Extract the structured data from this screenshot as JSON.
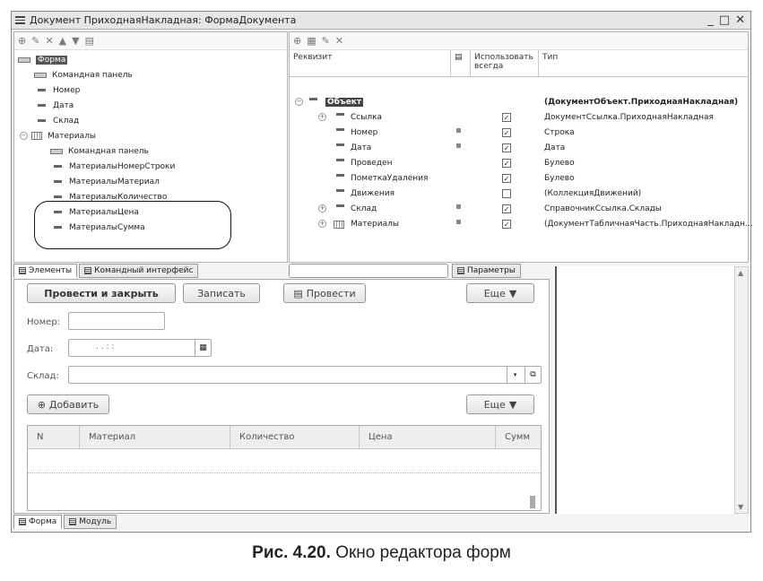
{
  "window": {
    "title": "Документ ПриходнаяНакладная: ФормаДокумента",
    "controls": [
      "_",
      "□",
      "✕"
    ]
  },
  "tree": {
    "items": [
      {
        "label": "Форма",
        "level": 0,
        "icon": "form-icon",
        "selected": true
      },
      {
        "label": "Командная панель",
        "level": 1,
        "icon": "command-panel-icon"
      },
      {
        "label": "Номер",
        "level": 1,
        "icon": "field-icon"
      },
      {
        "label": "Дата",
        "level": 1,
        "icon": "field-icon"
      },
      {
        "label": "Склад",
        "level": 1,
        "icon": "field-icon"
      },
      {
        "label": "Материалы",
        "level": 1,
        "icon": "table-icon",
        "expandable": true
      },
      {
        "label": "Командная панель",
        "level": 2,
        "icon": "command-panel-icon"
      },
      {
        "label": "МатериалыНомерСтроки",
        "level": 2,
        "icon": "field-icon"
      },
      {
        "label": "МатериалыМатериал",
        "level": 2,
        "icon": "field-icon"
      },
      {
        "label": "МатериалыКоличество",
        "level": 2,
        "icon": "field-icon"
      },
      {
        "label": "МатериалыЦена",
        "level": 2,
        "icon": "field-icon"
      },
      {
        "label": "МатериалыСумма",
        "level": 2,
        "icon": "field-icon"
      }
    ]
  },
  "left_tabs": {
    "elements": "Элементы",
    "command_interface": "Командный интерфейс"
  },
  "props": {
    "headers": {
      "name": "Реквизит",
      "use_always": "Использовать всегда",
      "type": "Тип"
    },
    "rows": [
      {
        "name": "Объект",
        "type": "(ДокументОбъект.ПриходнаяНакладная)",
        "root": true,
        "checked": null,
        "sq": false
      },
      {
        "name": "Ссылка",
        "type": "ДокументСсылка.ПриходнаяНакладная",
        "expandable": true,
        "checked": true,
        "sq": false
      },
      {
        "name": "Номер",
        "type": "Строка",
        "checked": true,
        "sq": true
      },
      {
        "name": "Дата",
        "type": "Дата",
        "checked": true,
        "sq": true
      },
      {
        "name": "Проведен",
        "type": "Булево",
        "checked": true,
        "sq": false
      },
      {
        "name": "ПометкаУдаления",
        "type": "Булево",
        "checked": true,
        "sq": false
      },
      {
        "name": "Движения",
        "type": "(КоллекцияДвижений)",
        "checked": false,
        "sq": false
      },
      {
        "name": "Склад",
        "type": "СправочникСсылка.Склады",
        "expandable": true,
        "checked": true,
        "sq": true
      },
      {
        "name": "Материалы",
        "type": "(ДокументТабличнаяЧасть.ПриходнаяНакладн...",
        "expandable": true,
        "checked": true,
        "sq": true,
        "table": true
      }
    ],
    "params_tab": "Параметры"
  },
  "form": {
    "post_close": "Провести и закрыть",
    "save": "Записать",
    "post": "Провести",
    "more": "Еще",
    "number_label": "Номер:",
    "date_label": "Дата:",
    "date_value": ". .   : :",
    "warehouse_label": "Склад:",
    "add": "Добавить",
    "more2": "Еще",
    "columns": [
      "N",
      "Материал",
      "Количество",
      "Цена",
      "Сумм"
    ]
  },
  "bottom_tabs": {
    "form": "Форма",
    "module": "Модуль"
  },
  "caption": {
    "bold": "Рис. 4.20.",
    "text": " Окно редактора форм"
  }
}
